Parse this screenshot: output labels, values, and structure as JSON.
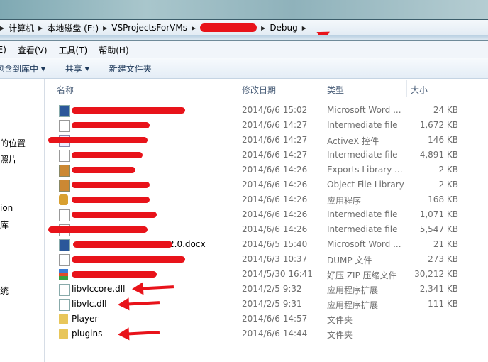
{
  "breadcrumb": [
    "计算机",
    "本地磁盘 (E:)",
    "VSProjectsForVMs",
    "",
    "Debug"
  ],
  "menu": [
    "(E)",
    "查看(V)",
    "工具(T)",
    "帮助(H)"
  ],
  "toolbar": {
    "include": "包含到库中",
    "share": "共享",
    "new_folder": "新建文件夹"
  },
  "sidebar": [
    "的位置",
    "照片",
    "ion",
    "库",
    "统"
  ],
  "columns": {
    "name": "名称",
    "date": "修改日期",
    "type": "类型",
    "size": "大小"
  },
  "files": [
    {
      "name": "",
      "date": "2014/6/6 15:02",
      "type": "Microsoft Word ...",
      "size": "24 KB",
      "icon": "word-doc-icon"
    },
    {
      "name": "",
      "date": "2014/6/6 14:27",
      "type": "Intermediate file",
      "size": "1,672 KB",
      "icon": "file-icon"
    },
    {
      "name": "",
      "date": "2014/6/6 14:27",
      "type": "ActiveX 控件",
      "size": "146 KB",
      "icon": "activex-icon"
    },
    {
      "name": "",
      "date": "2014/6/6 14:27",
      "type": "Intermediate file",
      "size": "4,891 KB",
      "icon": "file-icon"
    },
    {
      "name": "",
      "date": "2014/6/6 14:26",
      "type": "Exports Library ...",
      "size": "2 KB",
      "icon": "library-icon"
    },
    {
      "name": "",
      "date": "2014/6/6 14:26",
      "type": "Object File Library",
      "size": "2 KB",
      "icon": "library-icon"
    },
    {
      "name": "",
      "date": "2014/6/6 14:26",
      "type": "应用程序",
      "size": "168 KB",
      "icon": "exe-icon"
    },
    {
      "name": "",
      "date": "2014/6/6 14:26",
      "type": "Intermediate file",
      "size": "1,071 KB",
      "icon": "file-icon"
    },
    {
      "name": "",
      "date": "2014/6/6 14:26",
      "type": "Intermediate file",
      "size": "5,547 KB",
      "icon": "file-icon"
    },
    {
      "name": "2.0.docx",
      "date": "2014/6/5 15:40",
      "type": "Microsoft Word ...",
      "size": "21 KB",
      "icon": "word-doc-icon"
    },
    {
      "name": "",
      "date": "2014/6/3 10:37",
      "type": "DUMP 文件",
      "size": "273 KB",
      "icon": "file-icon"
    },
    {
      "name": "",
      "date": "2014/5/30 16:41",
      "type": "好压 ZIP 压缩文件",
      "size": "30,212 KB",
      "icon": "zip-icon"
    },
    {
      "name": "libvlccore.dll",
      "date": "2014/2/5 9:32",
      "type": "应用程序扩展",
      "size": "2,341 KB",
      "icon": "dll-icon"
    },
    {
      "name": "libvlc.dll",
      "date": "2014/2/5 9:31",
      "type": "应用程序扩展",
      "size": "111 KB",
      "icon": "dll-icon"
    },
    {
      "name": "Player",
      "date": "2014/6/6 14:57",
      "type": "文件夹",
      "size": "",
      "icon": "folder-icon"
    },
    {
      "name": "plugins",
      "date": "2014/6/6 14:44",
      "type": "文件夹",
      "size": "",
      "icon": "folder-icon"
    }
  ]
}
